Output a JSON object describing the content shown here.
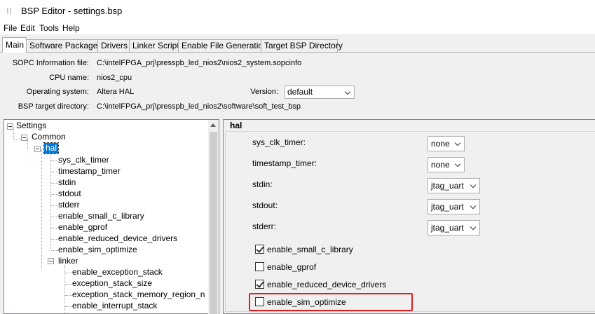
{
  "window": {
    "title": "BSP Editor - settings.bsp",
    "icon": "app-dots-icon"
  },
  "menu": [
    "File",
    "Edit",
    "Tools",
    "Help"
  ],
  "tabs": [
    {
      "label": "Main",
      "active": true
    },
    {
      "label": "Software Packages"
    },
    {
      "label": "Drivers"
    },
    {
      "label": "Linker Script"
    },
    {
      "label": "Enable File Generation"
    },
    {
      "label": "Target BSP Directory"
    }
  ],
  "info": {
    "sopc_label": "SOPC Information file:",
    "sopc_value": "C:\\intelFPGA_prj\\presspb_led_nios2\\nios2_system.sopcinfo",
    "cpu_label": "CPU name:",
    "cpu_value": "nios2_cpu",
    "os_label": "Operating system:",
    "os_value": "Altera HAL",
    "version_label": "Version:",
    "version_value": "default",
    "bsp_label": "BSP target directory:",
    "bsp_value": "C:\\intelFPGA_prj\\presspb_led_nios2\\software\\soft_test_bsp"
  },
  "tree": {
    "root": "Settings",
    "common": "Common",
    "hal": "hal",
    "hal_children": [
      "sys_clk_timer",
      "timestamp_timer",
      "stdin",
      "stdout",
      "stderr",
      "enable_small_c_library",
      "enable_gprof",
      "enable_reduced_device_drivers",
      "enable_sim_optimize"
    ],
    "linker": "linker",
    "linker_children": [
      "enable_exception_stack",
      "exception_stack_size",
      "exception_stack_memory_region_n",
      "enable_interrupt_stack"
    ]
  },
  "panel": {
    "title": "hal",
    "settings": [
      {
        "label": "sys_clk_timer:",
        "value": "none"
      },
      {
        "label": "timestamp_timer:",
        "value": "none"
      },
      {
        "label": "stdin:",
        "value": "jtag_uart"
      },
      {
        "label": "stdout:",
        "value": "jtag_uart"
      },
      {
        "label": "stderr:",
        "value": "jtag_uart"
      }
    ],
    "checks": [
      {
        "label": "enable_small_c_library",
        "checked": true
      },
      {
        "label": "enable_gprof",
        "checked": false
      },
      {
        "label": "enable_reduced_device_drivers",
        "checked": true
      },
      {
        "label": "enable_sim_optimize",
        "checked": false
      }
    ]
  },
  "colors": {
    "highlight": "#e02020",
    "selection": "#0078d7"
  }
}
